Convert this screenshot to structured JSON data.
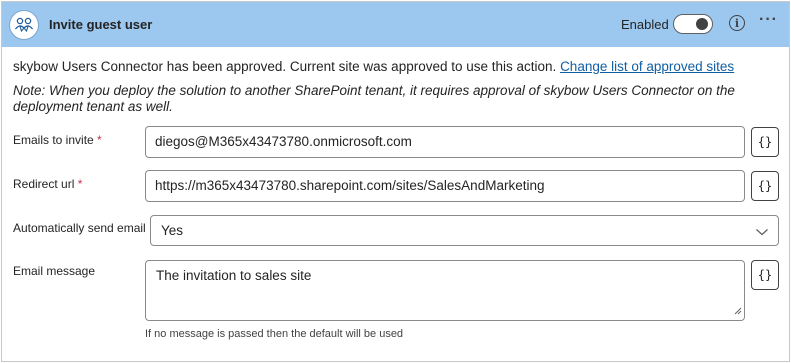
{
  "header": {
    "title": "Invite guest user",
    "enabled_label": "Enabled",
    "enabled": true,
    "icon": "people-icon",
    "info_icon": "info-icon",
    "more_label": "···"
  },
  "approval": {
    "text": "skybow Users Connector has been approved. Current site was approved to use this action.",
    "link": "Change list of approved sites"
  },
  "note": "Note: When you deploy the solution to another SharePoint tenant, it requires approval of skybow Users Connector on the deployment tenant as well.",
  "fields": {
    "emails": {
      "label": "Emails to invite",
      "required_mark": "*",
      "value": "diegos@M365x43473780.onmicrosoft.com",
      "dynamic_label": "{}"
    },
    "redirect": {
      "label": "Redirect url",
      "required_mark": "*",
      "value": "https://m365x43473780.sharepoint.com/sites/SalesAndMarketing",
      "dynamic_label": "{}"
    },
    "auto_send": {
      "label": "Automatically send email",
      "value": "Yes"
    },
    "message": {
      "label": "Email message",
      "value": "The invitation to sales site",
      "dynamic_label": "{}",
      "hint": "If no message is passed then the default will be used"
    }
  },
  "colors": {
    "header_bg": "#9cc7ee",
    "link": "#115ea3",
    "required": "#c4314b"
  }
}
